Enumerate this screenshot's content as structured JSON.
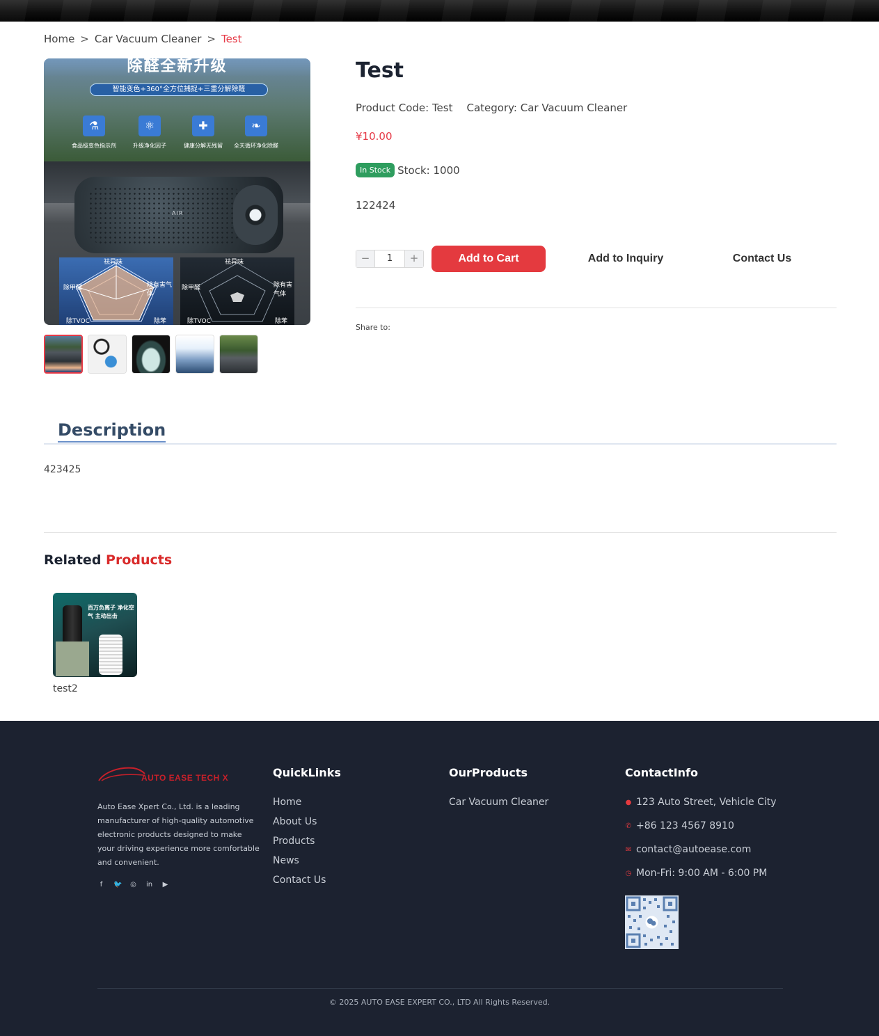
{
  "breadcrumb": {
    "home": "Home",
    "category": "Car Vacuum Cleaner",
    "current": "Test",
    "separator": ">"
  },
  "gallery": {
    "main_image_caption": "除醛全新升级",
    "main_image_banner": "智能变色+360°全方位捕捉+三重分解除醛",
    "features": [
      "食品级变色指示剂",
      "升级净化因子",
      "健康分解无残留",
      "全天循环净化除醛"
    ],
    "device_label": "AIR",
    "radar_left_labels": [
      "祛异味",
      "除甲醛",
      "除有害气体",
      "除TVOC",
      "除苯"
    ],
    "radar_right_labels": [
      "祛异味",
      "除甲醛",
      "除有害气体",
      "除TVOC",
      "除苯"
    ],
    "thumbnails": [
      {
        "name": "air-purifier-thumb",
        "active": true
      },
      {
        "name": "inflator-gun-thumb",
        "active": false
      },
      {
        "name": "purifier-box-thumb",
        "active": false
      },
      {
        "name": "product-poster-thumb",
        "active": false
      },
      {
        "name": "car-road-thumb",
        "active": false
      }
    ]
  },
  "product": {
    "title": "Test",
    "code_label": "Product Code: Test",
    "category_label": "Category: Car Vacuum Cleaner",
    "price": "¥10.00",
    "stock_badge": "In Stock",
    "stock_text": "Stock: 1000",
    "sku": "122424",
    "quantity": "1",
    "add_to_cart": "Add to Cart",
    "add_to_inquiry": "Add to Inquiry",
    "contact_us": "Contact Us",
    "share_label": "Share to:"
  },
  "description": {
    "tab": "Description",
    "body": "423425"
  },
  "related": {
    "title_plain": "Related",
    "title_accent": "Products",
    "items": [
      {
        "name": "test2",
        "image_text": "百万负离子 净化空气 主动出击"
      }
    ]
  },
  "footer": {
    "logo_text": "AUTO EASE TECH X",
    "about": "Auto Ease Xpert Co., Ltd. is a leading manufacturer of high-quality automotive electronic products designed to make your driving experience more comfortable and convenient.",
    "social_icons": [
      "facebook-icon",
      "twitter-icon",
      "instagram-icon",
      "linkedin-icon",
      "youtube-icon"
    ],
    "quicklinks_title": "QuickLinks",
    "quicklinks": [
      "Home",
      "About Us",
      "Products",
      "News",
      "Contact Us"
    ],
    "products_title": "OurProducts",
    "products": [
      "Car Vacuum Cleaner"
    ],
    "contact_title": "ContactInfo",
    "address": "123 Auto Street, Vehicle City",
    "phone": "+86 123 4567 8910",
    "email": "contact@autoease.com",
    "hours": "Mon-Fri: 9:00 AM - 6:00 PM",
    "copyright": "© 2025 AUTO EASE EXPERT CO., LTD All Rights Reserved."
  },
  "colors": {
    "accent_red": "#e43a3f",
    "stock_green": "#2e9d5e",
    "footer_bg": "#1c2230",
    "title_dark": "#1c2331"
  }
}
